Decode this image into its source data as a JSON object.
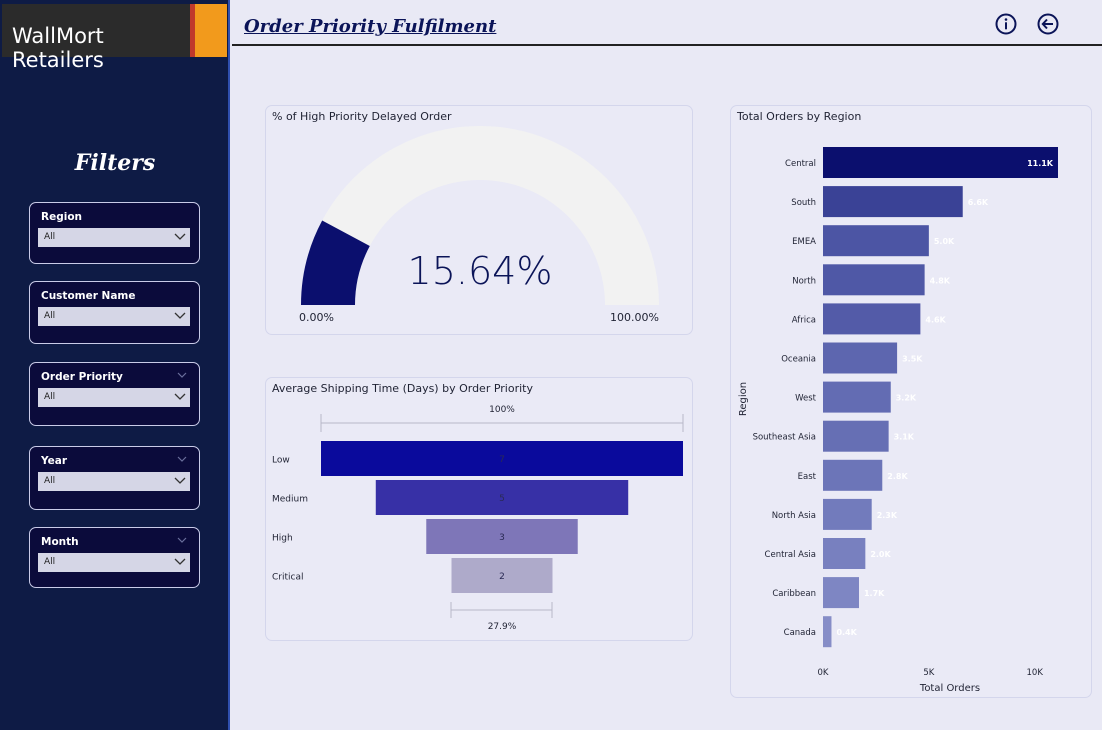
{
  "brand": {
    "name": "WallMort Retailers"
  },
  "sidebar": {
    "title": "Filters",
    "slicers": [
      {
        "label": "Region",
        "value": "All"
      },
      {
        "label": "Customer Name",
        "value": "All"
      },
      {
        "label": "Order Priority",
        "value": "All"
      },
      {
        "label": "Year",
        "value": "All"
      },
      {
        "label": "Month",
        "value": "All"
      }
    ]
  },
  "header": {
    "title": "Order Priority Fulfilment",
    "info_icon": "info-icon",
    "back_icon": "back-arrow-icon"
  },
  "colors": {
    "sidebar_bg": "#0e1b45",
    "accent_orange": "#f29a1c",
    "accent_red": "#c0392b",
    "gauge_fill": "#0b0f6e",
    "gauge_track": "#f2f2f2",
    "page_bg": "#e9e9f5"
  },
  "gauge": {
    "title": "% of High Priority Delayed Order",
    "value_label": "15.64%",
    "value": 15.64,
    "min_label": "0.00%",
    "max_label": "100.00%"
  },
  "funnel": {
    "title": "Average Shipping Time (Days) by Order Priority",
    "top_pct_label": "100%",
    "bottom_pct_label": "27.9%"
  },
  "region_chart": {
    "title": "Total Orders by Region",
    "xlabel": "Total Orders",
    "ylabel": "Region"
  },
  "chart_data": [
    {
      "type": "bar",
      "orientation": "horizontal",
      "title": "Total Orders by Region",
      "xlabel": "Total Orders",
      "ylabel": "Region",
      "categories": [
        "Central",
        "South",
        "EMEA",
        "North",
        "Africa",
        "Oceania",
        "West",
        "Southeast Asia",
        "East",
        "North Asia",
        "Central Asia",
        "Caribbean",
        "Canada"
      ],
      "values": [
        11100,
        6600,
        5000,
        4800,
        4600,
        3500,
        3200,
        3100,
        2800,
        2300,
        2000,
        1700,
        400
      ],
      "data_labels": [
        "11.1K",
        "6.6K",
        "5.0K",
        "4.8K",
        "4.6K",
        "3.5K",
        "3.2K",
        "3.1K",
        "2.8K",
        "2.3K",
        "2.0K",
        "1.7K",
        "0.4K"
      ],
      "xlim": [
        0,
        11100
      ],
      "xticks": [
        0,
        5000,
        10000
      ],
      "xtick_labels": [
        "0K",
        "5K",
        "10K"
      ],
      "bar_colors": [
        "#0b0f6e",
        "#3a4296",
        "#4c55a4",
        "#4f58a6",
        "#535ba8",
        "#5d66af",
        "#636cb3",
        "#666fb4",
        "#6c75b8",
        "#727bbc",
        "#7880bf",
        "#7e86c3",
        "#868dc7"
      ]
    },
    {
      "type": "funnel",
      "title": "Average Shipping Time (Days) by Order Priority",
      "categories": [
        "Low",
        "Medium",
        "High",
        "Critical"
      ],
      "values": [
        7.17,
        5,
        3,
        2
      ],
      "data_labels": [
        "7",
        "5",
        "3",
        "2"
      ],
      "top_pct_label": "100%",
      "bottom_pct_label": "27.9%",
      "bar_colors": [
        "#0a0a9c",
        "#3730a6",
        "#7e76b8",
        "#aeaaca"
      ]
    },
    {
      "type": "gauge",
      "title": "% of High Priority Delayed Order",
      "value": 15.64,
      "min": 0,
      "max": 100,
      "value_label": "15.64%",
      "min_label": "0.00%",
      "max_label": "100.00%"
    }
  ]
}
